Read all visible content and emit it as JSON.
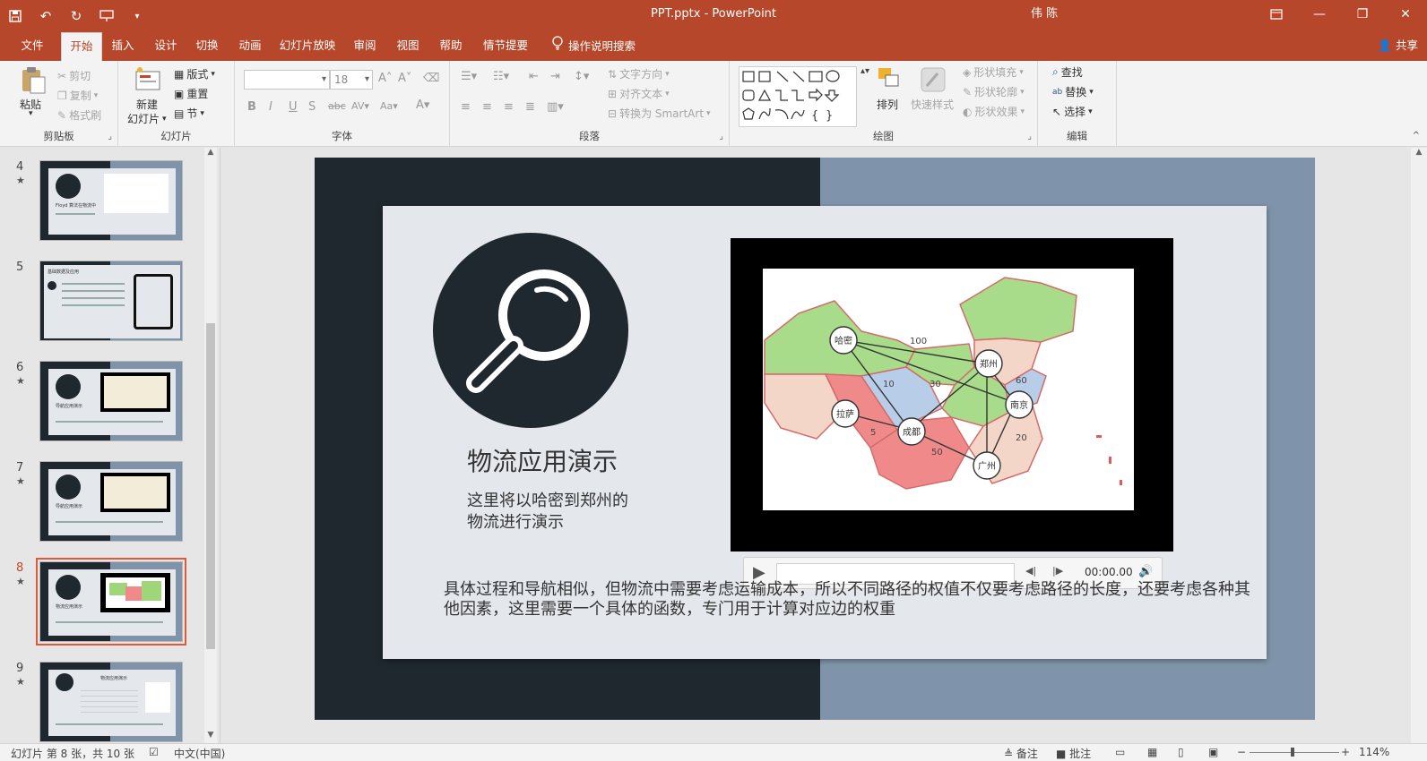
{
  "titlebar": {
    "doc_title": "PPT.pptx  -  PowerPoint",
    "user": "伟 陈",
    "qat_icons": [
      "save-icon",
      "undo-icon",
      "redo-icon",
      "presenter-icon",
      "customize-icon"
    ]
  },
  "tabs": [
    {
      "label": "文件"
    },
    {
      "label": "开始"
    },
    {
      "label": "插入"
    },
    {
      "label": "设计"
    },
    {
      "label": "切换"
    },
    {
      "label": "动画"
    },
    {
      "label": "幻灯片放映"
    },
    {
      "label": "审阅"
    },
    {
      "label": "视图"
    },
    {
      "label": "帮助"
    },
    {
      "label": "情节提要"
    }
  ],
  "tell_me": "操作说明搜索",
  "share": "共享",
  "ribbon": {
    "clipboard": {
      "label": "剪贴板",
      "paste": "粘贴",
      "cut": "剪切",
      "copy": "复制",
      "format_painter": "格式刷"
    },
    "slides": {
      "label": "幻灯片",
      "new_slide_1": "新建",
      "new_slide_2": "幻灯片",
      "layout": "版式",
      "reset": "重置",
      "section": "节"
    },
    "font": {
      "label": "字体",
      "font_name": "",
      "font_size": "18"
    },
    "paragraph": {
      "label": "段落",
      "text_direction": "文字方向",
      "align_text": "对齐文本",
      "smartart": "转换为 SmartArt"
    },
    "drawing": {
      "label": "绘图",
      "arrange": "排列",
      "quick_styles": "快速样式",
      "shape_fill": "形状填充",
      "shape_outline": "形状轮廓",
      "shape_effects": "形状效果"
    },
    "editing": {
      "label": "编辑",
      "find": "查找",
      "replace": "替换",
      "select": "选择"
    }
  },
  "thumbnails": [
    {
      "num": "4",
      "star": "★",
      "caption": "Floyd 算法在物流中"
    },
    {
      "num": "5",
      "star": "",
      "caption": "基础数据及应用"
    },
    {
      "num": "6",
      "star": "★",
      "caption": "导航应用演示"
    },
    {
      "num": "7",
      "star": "★",
      "caption": "导航应用演示"
    },
    {
      "num": "8",
      "star": "★",
      "caption": "物流应用演示"
    },
    {
      "num": "9",
      "star": "★",
      "caption": "物流应用演示"
    }
  ],
  "slide": {
    "title": "物流应用演示",
    "subtitle": "这里将以哈密到郑州的物流进行演示",
    "body": "具体过程和导航相似，但物流中需要考虑运输成本，所以不同路径的权值不仅要考虑路径的长度，还要考虑各种其他因素，这里需要一个具体的函数，专门用于计算对应边的权重",
    "map": {
      "nodes": [
        {
          "label": "哈密"
        },
        {
          "label": "郑州"
        },
        {
          "label": "南京"
        },
        {
          "label": "拉萨"
        },
        {
          "label": "成都"
        },
        {
          "label": "广州"
        }
      ],
      "edge_labels": [
        "100",
        "10",
        "30",
        "60",
        "5",
        "50",
        "20"
      ]
    },
    "player": {
      "time": "00:00.00"
    }
  },
  "statusbar": {
    "slide_info": "幻灯片 第 8 张，共 10 张",
    "language": "中文(中国)",
    "notes": "备注",
    "comments": "批注",
    "zoom": "114%"
  }
}
